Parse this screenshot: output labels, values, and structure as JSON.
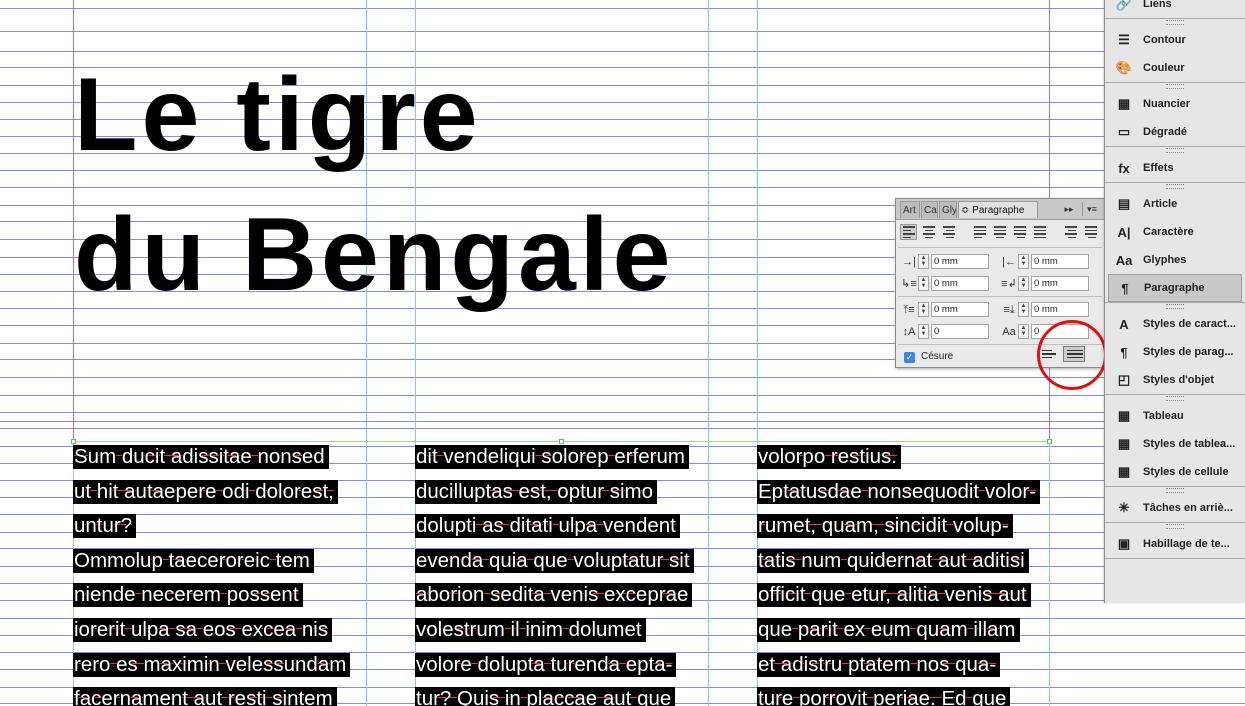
{
  "document": {
    "title_lines": [
      "Le tigre",
      "du Bengale"
    ],
    "columns": [
      [
        "Sum ducit adissitae nonsed",
        "ut hit autaepere odi dolorest,",
        "untur?",
        "Ommolup taeceroreic tem",
        "niende necerem possent",
        "iorerit ulpa sa eos excea nis",
        "rero es maximin velessundam",
        "facernament aut resti sintem"
      ],
      [
        "dit vendeliqui solorep erferum",
        "ducilluptas est, optur simo",
        "dolupti as ditati ulpa vendent",
        "evenda quia que voluptatur sit",
        "aborion sedita venis exceprae",
        "volestrum il inim dolumet",
        "volore dolupta turenda epta-",
        "tur? Quis in placcae aut que"
      ],
      [
        "volorpo restius.",
        "Eptatusdae nonsequodit volor-",
        "rumet, quam, sincidit volup-",
        "tatis num quidernat aut aditisi",
        "officit que etur, alitia venis aut",
        "que parit ex eum quam illam",
        "et adistru ptatem nos qua-",
        "ture porrovit periae. Ed que"
      ]
    ]
  },
  "paragraph_panel": {
    "tabs": [
      "Art",
      "Ca",
      "Gly"
    ],
    "active_tab": "Paragraphe",
    "fields": [
      "0 mm",
      "0 mm",
      "0 mm",
      "0 mm",
      "0 mm",
      "0 mm",
      "0",
      "0"
    ],
    "hyphenation_label": "Césure",
    "hyphenation_checked": true,
    "icons": {
      "left_indent": "left-indent-icon",
      "right_indent": "right-indent-icon",
      "first_line_indent": "first-line-indent-icon",
      "last_line_indent": "last-line-indent-icon",
      "space_before": "space-before-icon",
      "space_after": "space-after-icon",
      "drop_cap_lines": "drop-cap-lines-icon",
      "drop_cap_chars": "drop-cap-chars-icon"
    }
  },
  "dock": {
    "items": [
      {
        "label": "Liens",
        "icon": "links-icon"
      },
      {
        "label": "Contour",
        "icon": "stroke-icon"
      },
      {
        "label": "Couleur",
        "icon": "color-icon"
      },
      {
        "label": "Nuancier",
        "icon": "swatches-icon"
      },
      {
        "label": "Dégradé",
        "icon": "gradient-icon"
      },
      {
        "label": "Effets",
        "icon": "effects-icon"
      },
      {
        "label": "Article",
        "icon": "story-icon"
      },
      {
        "label": "Caractère",
        "icon": "character-icon"
      },
      {
        "label": "Glyphes",
        "icon": "glyphs-icon"
      },
      {
        "label": "Paragraphe",
        "icon": "paragraph-icon"
      },
      {
        "label": "Styles de caract...",
        "icon": "character-styles-icon"
      },
      {
        "label": "Styles de parag...",
        "icon": "paragraph-styles-icon"
      },
      {
        "label": "Styles d'objet",
        "icon": "object-styles-icon"
      },
      {
        "label": "Tableau",
        "icon": "table-icon"
      },
      {
        "label": "Styles de tablea...",
        "icon": "table-styles-icon"
      },
      {
        "label": "Styles de cellule",
        "icon": "cell-styles-icon"
      },
      {
        "label": "Tâches en arriè...",
        "icon": "background-tasks-icon"
      },
      {
        "label": "Habillage de te...",
        "icon": "text-wrap-icon"
      }
    ],
    "selected": "Paragraphe"
  },
  "colors": {
    "highlight": "#000000",
    "baseline_grid": "#7e8be8",
    "column_guide": "#6fd6e8",
    "margin_guide": "#b26be0",
    "annotation_circle": "#e01010"
  }
}
